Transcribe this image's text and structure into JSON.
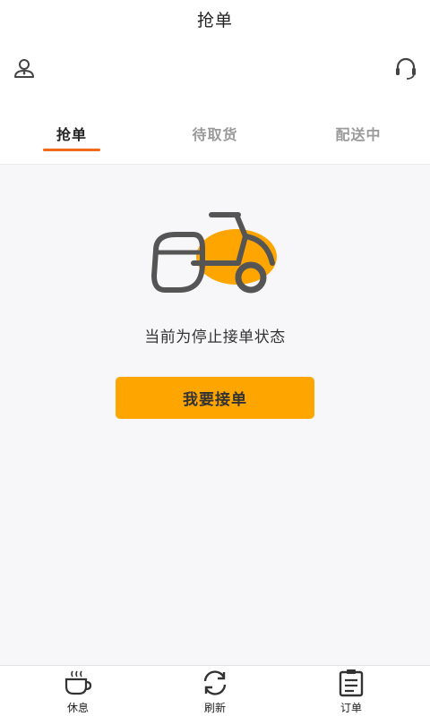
{
  "header": {
    "title": "抢单",
    "left_icon": "rider-profile-icon",
    "right_icon": "headset-icon"
  },
  "tabs": [
    {
      "label": "抢单",
      "active": true
    },
    {
      "label": "待取货",
      "active": false
    },
    {
      "label": "配送中",
      "active": false
    }
  ],
  "empty_state": {
    "illustration": "scooter-icon",
    "message": "当前为停止接单状态",
    "button_label": "我要接单"
  },
  "bottom_nav": {
    "items": [
      {
        "label": "休息",
        "icon": "coffee-cup-icon"
      },
      {
        "label": "刷新",
        "icon": "refresh-icon"
      },
      {
        "label": "订单",
        "icon": "order-list-icon"
      }
    ]
  },
  "colors": {
    "accent": "#ffa500",
    "tab_indicator": "#f06a1a",
    "icon_gray": "#555555",
    "background": "#f7f6f8"
  }
}
